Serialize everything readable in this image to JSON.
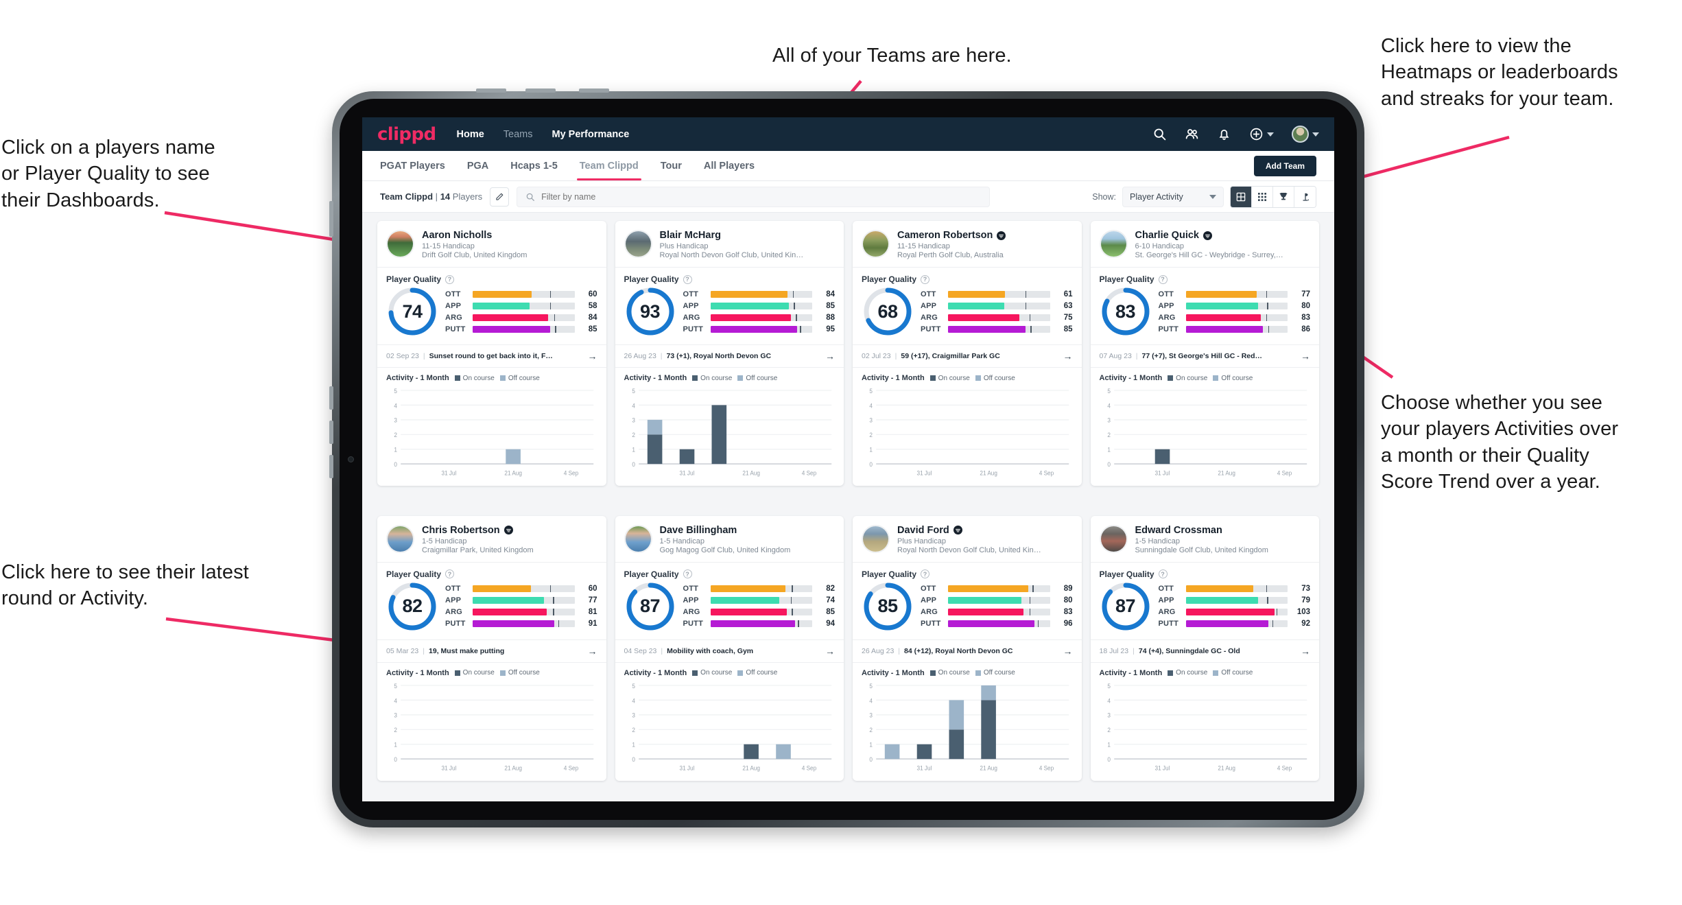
{
  "annotations": [
    {
      "id": "teams",
      "text": "All of your Teams are here."
    },
    {
      "id": "heatmaps",
      "text": "Click here to view the\nHeatmaps or leaderboards\nand streaks for your team."
    },
    {
      "id": "playername",
      "text": "Click on a players name\nor Player Quality to see\ntheir Dashboards."
    },
    {
      "id": "activity",
      "text": "Choose whether you see\nyour players Activities over\na month or their Quality\nScore Trend over a year."
    },
    {
      "id": "latest",
      "text": "Click here to see their latest\nround or Activity."
    }
  ],
  "nav": {
    "brand": "clippd",
    "links": [
      {
        "label": "Home",
        "active": true
      },
      {
        "label": "Teams",
        "active": false
      },
      {
        "label": "My Performance",
        "active": true
      }
    ],
    "icons": [
      "search-icon",
      "people-icon",
      "bell-icon",
      "plus-circle-icon",
      "avatar"
    ]
  },
  "tabs": [
    {
      "label": "PGAT Players",
      "active": false
    },
    {
      "label": "PGA",
      "active": false
    },
    {
      "label": "Hcaps 1-5",
      "active": false
    },
    {
      "label": "Team Clippd",
      "active": true
    },
    {
      "label": "Tour",
      "active": false
    },
    {
      "label": "All Players",
      "active": false
    }
  ],
  "add_team_label": "Add Team",
  "filterbar": {
    "team_name": "Team Clippd",
    "separator": "|",
    "player_count": "14",
    "players_word": "Players",
    "edit_icon": "pencil-icon",
    "search_placeholder": "Filter by name",
    "search_value": "",
    "show_label": "Show:",
    "show_value": "Player Activity",
    "show_options": [
      "Player Activity",
      "Quality Score Trend"
    ],
    "views": [
      {
        "name": "grid-large-view",
        "active": true
      },
      {
        "name": "grid-small-view",
        "active": false
      },
      {
        "name": "trophy-leaderboard-view",
        "active": false
      },
      {
        "name": "heatmap-view",
        "active": false
      }
    ]
  },
  "metric_colors": {
    "OTT": "#f5a623",
    "APP": "#3ddcb0",
    "ARG": "#f6165e",
    "PUTT": "#b51bd4",
    "ring": "#1878cf",
    "ring_track": "#dfe3e8",
    "on_course": "#4a5f70",
    "off_course": "#9cb4c9"
  },
  "chart_common": {
    "ylabels": [
      "5",
      "4",
      "3",
      "2",
      "1",
      "0"
    ],
    "xlabels": [
      "31 Jul",
      "21 Aug",
      "4 Sep"
    ],
    "ymax": 5,
    "legend": [
      "On course",
      "Off course"
    ],
    "title": "Activity - 1 Month"
  },
  "players": [
    {
      "name": "Aaron Nicholls",
      "verified": false,
      "handicap": "11-15 Handicap",
      "club": "Drift Golf Club, United Kingdom",
      "avatar_css": "linear-gradient(180deg,#e8a87c 0%,#cf7f63 22%,#3f6b3a 45%,#6aa95a 100%)",
      "quality_label": "Player Quality",
      "quality": 74,
      "metrics": [
        {
          "label": "OTT",
          "value": 60,
          "fill": 58,
          "tick": 76
        },
        {
          "label": "APP",
          "value": 58,
          "fill": 56,
          "tick": 76
        },
        {
          "label": "ARG",
          "value": 84,
          "fill": 74,
          "tick": 80
        },
        {
          "label": "PUTT",
          "value": 85,
          "fill": 76,
          "tick": 81
        }
      ],
      "latest_date": "02 Sep 23",
      "latest_text": "Sunset round to get back into it, F…",
      "chart_data": {
        "type": "bar",
        "title": "Activity - 1 Month",
        "categories": [
          "31 Jul",
          "21 Aug",
          "4 Sep"
        ],
        "series": [
          {
            "name": "On course",
            "values": [
              0,
              0,
              0,
              0,
              0,
              0
            ]
          },
          {
            "name": "Off course",
            "values": [
              0,
              0,
              0,
              1,
              0,
              0
            ]
          }
        ],
        "ylim": [
          0,
          5
        ],
        "ylabel": "",
        "xlabel": ""
      }
    },
    {
      "name": "Blair McHarg",
      "verified": false,
      "handicap": "Plus Handicap",
      "club": "Royal North Devon Golf Club, United Kin…",
      "avatar_css": "linear-gradient(180deg,#8ea0ad 0%,#5b6a72 40%,#7b8a78 70%,#9aa48c 100%)",
      "quality_label": "Player Quality",
      "quality": 93,
      "metrics": [
        {
          "label": "OTT",
          "value": 84,
          "fill": 76,
          "tick": 81
        },
        {
          "label": "APP",
          "value": 85,
          "fill": 77,
          "tick": 82
        },
        {
          "label": "ARG",
          "value": 88,
          "fill": 79,
          "tick": 84
        },
        {
          "label": "PUTT",
          "value": 95,
          "fill": 85,
          "tick": 88
        }
      ],
      "latest_date": "26 Aug 23",
      "latest_text": "73 (+1), Royal North Devon GC",
      "chart_data": {
        "type": "bar",
        "title": "Activity - 1 Month",
        "categories": [
          "31 Jul",
          "21 Aug",
          "4 Sep"
        ],
        "series": [
          {
            "name": "On course",
            "values": [
              2,
              1,
              4,
              0,
              0,
              0
            ]
          },
          {
            "name": "Off course",
            "values": [
              1,
              0,
              0,
              0,
              0,
              0
            ]
          }
        ],
        "ylim": [
          0,
          5
        ],
        "ylabel": "",
        "xlabel": ""
      }
    },
    {
      "name": "Cameron Robertson",
      "verified": true,
      "handicap": "11-15 Handicap",
      "club": "Royal Perth Golf Club, Australia",
      "avatar_css": "linear-gradient(180deg,#c9a96b 0%,#8d9e5e 35%,#5f7b3f 65%,#93a86a 100%)",
      "quality_label": "Player Quality",
      "quality": 68,
      "metrics": [
        {
          "label": "OTT",
          "value": 61,
          "fill": 56,
          "tick": 76
        },
        {
          "label": "APP",
          "value": 63,
          "fill": 55,
          "tick": 76
        },
        {
          "label": "ARG",
          "value": 75,
          "fill": 70,
          "tick": 80
        },
        {
          "label": "PUTT",
          "value": 85,
          "fill": 76,
          "tick": 81
        }
      ],
      "latest_date": "02 Jul 23",
      "latest_text": "59 (+17), Craigmillar Park GC",
      "chart_data": {
        "type": "bar",
        "title": "Activity - 1 Month",
        "categories": [
          "31 Jul",
          "21 Aug",
          "4 Sep"
        ],
        "series": [
          {
            "name": "On course",
            "values": [
              0,
              0,
              0,
              0,
              0,
              0
            ]
          },
          {
            "name": "Off course",
            "values": [
              0,
              0,
              0,
              0,
              0,
              0
            ]
          }
        ],
        "ylim": [
          0,
          5
        ],
        "ylabel": "",
        "xlabel": ""
      }
    },
    {
      "name": "Charlie Quick",
      "verified": true,
      "handicap": "6-10 Handicap",
      "club": "St. George's Hill GC - Weybridge - Surrey, …",
      "avatar_css": "linear-gradient(180deg,#bcd6ea 0%,#9fc4dd 30%,#5c8a4a 55%,#8bbf6d 100%)",
      "quality_label": "Player Quality",
      "quality": 83,
      "metrics": [
        {
          "label": "OTT",
          "value": 77,
          "fill": 70,
          "tick": 79
        },
        {
          "label": "APP",
          "value": 80,
          "fill": 71,
          "tick": 80
        },
        {
          "label": "ARG",
          "value": 83,
          "fill": 74,
          "tick": 79
        },
        {
          "label": "PUTT",
          "value": 86,
          "fill": 76,
          "tick": 81
        }
      ],
      "latest_date": "07 Aug 23",
      "latest_text": "77 (+7), St George's Hill GC - Red…",
      "chart_data": {
        "type": "bar",
        "title": "Activity - 1 Month",
        "categories": [
          "31 Jul",
          "21 Aug",
          "4 Sep"
        ],
        "series": [
          {
            "name": "On course",
            "values": [
              0,
              1,
              0,
              0,
              0,
              0
            ]
          },
          {
            "name": "Off course",
            "values": [
              0,
              0,
              0,
              0,
              0,
              0
            ]
          }
        ],
        "ylim": [
          0,
          5
        ],
        "ylabel": "",
        "xlabel": ""
      }
    },
    {
      "name": "Chris Robertson",
      "verified": true,
      "handicap": "1-5 Handicap",
      "club": "Craigmillar Park, United Kingdom",
      "avatar_css": "linear-gradient(180deg,#7fa46a 0%,#d7b49a 30%,#6d9ec9 62%,#4c7fae 100%)",
      "quality_label": "Player Quality",
      "quality": 82,
      "metrics": [
        {
          "label": "OTT",
          "value": 60,
          "fill": 57,
          "tick": 76
        },
        {
          "label": "APP",
          "value": 77,
          "fill": 70,
          "tick": 79
        },
        {
          "label": "ARG",
          "value": 81,
          "fill": 73,
          "tick": 79
        },
        {
          "label": "PUTT",
          "value": 91,
          "fill": 80,
          "tick": 84
        }
      ],
      "latest_date": "05 Mar 23",
      "latest_text": "19, Must make putting",
      "chart_data": {
        "type": "bar",
        "title": "Activity - 1 Month",
        "categories": [
          "31 Jul",
          "21 Aug",
          "4 Sep"
        ],
        "series": [
          {
            "name": "On course",
            "values": [
              0,
              0,
              0,
              0,
              0,
              0
            ]
          },
          {
            "name": "Off course",
            "values": [
              0,
              0,
              0,
              0,
              0,
              0
            ]
          }
        ],
        "ylim": [
          0,
          5
        ],
        "ylabel": "",
        "xlabel": ""
      }
    },
    {
      "name": "Dave Billingham",
      "verified": false,
      "handicap": "1-5 Handicap",
      "club": "Gog Magog Golf Club, United Kingdom",
      "avatar_css": "linear-gradient(180deg,#6f9a55 0%,#d9b498 28%,#6fa0cc 62%,#4b7fae 100%)",
      "quality_label": "Player Quality",
      "quality": 87,
      "metrics": [
        {
          "label": "OTT",
          "value": 82,
          "fill": 74,
          "tick": 80
        },
        {
          "label": "APP",
          "value": 74,
          "fill": 68,
          "tick": 79
        },
        {
          "label": "ARG",
          "value": 85,
          "fill": 75,
          "tick": 80
        },
        {
          "label": "PUTT",
          "value": 94,
          "fill": 83,
          "tick": 86
        }
      ],
      "latest_date": "04 Sep 23",
      "latest_text": "Mobility with coach, Gym",
      "chart_data": {
        "type": "bar",
        "title": "Activity - 1 Month",
        "categories": [
          "31 Jul",
          "21 Aug",
          "4 Sep"
        ],
        "series": [
          {
            "name": "On course",
            "values": [
              0,
              0,
              0,
              1,
              0,
              0
            ]
          },
          {
            "name": "Off course",
            "values": [
              0,
              0,
              0,
              0,
              1,
              0
            ]
          }
        ],
        "ylim": [
          0,
          5
        ],
        "ylabel": "",
        "xlabel": ""
      }
    },
    {
      "name": "David Ford",
      "verified": true,
      "handicap": "Plus Handicap",
      "club": "Royal North Devon Golf Club, United Kin…",
      "avatar_css": "linear-gradient(180deg,#9fb9cd 0%,#7c97ad 30%,#b3a77e 60%,#cbbd8d 100%)",
      "quality_label": "Player Quality",
      "quality": 85,
      "metrics": [
        {
          "label": "OTT",
          "value": 89,
          "fill": 79,
          "tick": 83
        },
        {
          "label": "APP",
          "value": 80,
          "fill": 72,
          "tick": 80
        },
        {
          "label": "ARG",
          "value": 83,
          "fill": 74,
          "tick": 80
        },
        {
          "label": "PUTT",
          "value": 96,
          "fill": 85,
          "tick": 88
        }
      ],
      "latest_date": "26 Aug 23",
      "latest_text": "84 (+12), Royal North Devon GC",
      "chart_data": {
        "type": "bar",
        "title": "Activity - 1 Month",
        "categories": [
          "31 Jul",
          "21 Aug",
          "4 Sep"
        ],
        "series": [
          {
            "name": "On course",
            "values": [
              0,
              1,
              2,
              4,
              0,
              0
            ]
          },
          {
            "name": "Off course",
            "values": [
              1,
              0,
              2,
              1,
              0,
              0
            ]
          }
        ],
        "ylim": [
          0,
          5
        ],
        "ylabel": "",
        "xlabel": ""
      }
    },
    {
      "name": "Edward Crossman",
      "verified": false,
      "handicap": "1-5 Handicap",
      "club": "Sunningdale Golf Club, United Kingdom",
      "avatar_css": "linear-gradient(180deg,#8c8b86 0%,#6a6460 30%,#a4675a 58%,#4f4b48 100%)",
      "quality_label": "Player Quality",
      "quality": 87,
      "metrics": [
        {
          "label": "OTT",
          "value": 73,
          "fill": 66,
          "tick": 79
        },
        {
          "label": "APP",
          "value": 79,
          "fill": 71,
          "tick": 80
        },
        {
          "label": "ARG",
          "value": 103,
          "fill": 87,
          "tick": 89
        },
        {
          "label": "PUTT",
          "value": 92,
          "fill": 81,
          "tick": 85
        }
      ],
      "latest_date": "18 Jul 23",
      "latest_text": "74 (+4), Sunningdale GC - Old",
      "chart_data": {
        "type": "bar",
        "title": "Activity - 1 Month",
        "categories": [
          "31 Jul",
          "21 Aug",
          "4 Sep"
        ],
        "series": [
          {
            "name": "On course",
            "values": [
              0,
              0,
              0,
              0,
              0,
              0
            ]
          },
          {
            "name": "Off course",
            "values": [
              0,
              0,
              0,
              0,
              0,
              0
            ]
          }
        ],
        "ylim": [
          0,
          5
        ],
        "ylabel": "",
        "xlabel": ""
      }
    }
  ]
}
